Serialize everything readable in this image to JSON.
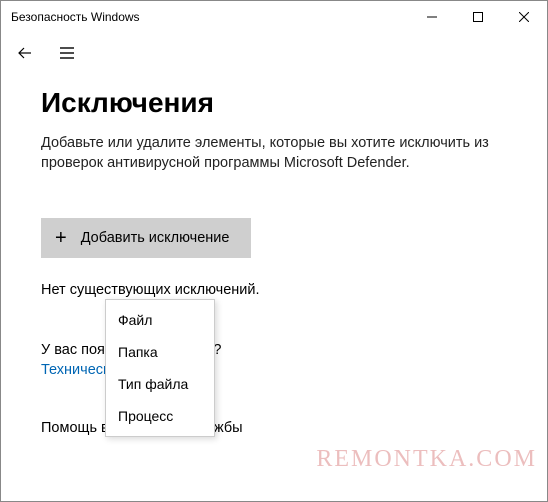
{
  "window": {
    "title": "Безопасность Windows"
  },
  "page": {
    "heading": "Исключения",
    "description": "Добавьте или удалите элементы, которые вы хотите исключить из проверок антивирусной программы Microsoft Defender."
  },
  "add_button": {
    "label": "Добавить исключение"
  },
  "status": {
    "text": "Нет существующих исключений."
  },
  "question": {
    "prompt": "У вас появились вопросы?",
    "link": "Техническая поддержка"
  },
  "help": {
    "heading": "Помощь в улучшении службы"
  },
  "menu": {
    "items": [
      {
        "label": "Файл"
      },
      {
        "label": "Папка"
      },
      {
        "label": "Тип файла"
      },
      {
        "label": "Процесс"
      }
    ]
  },
  "watermark": "REMONTKA.COM"
}
